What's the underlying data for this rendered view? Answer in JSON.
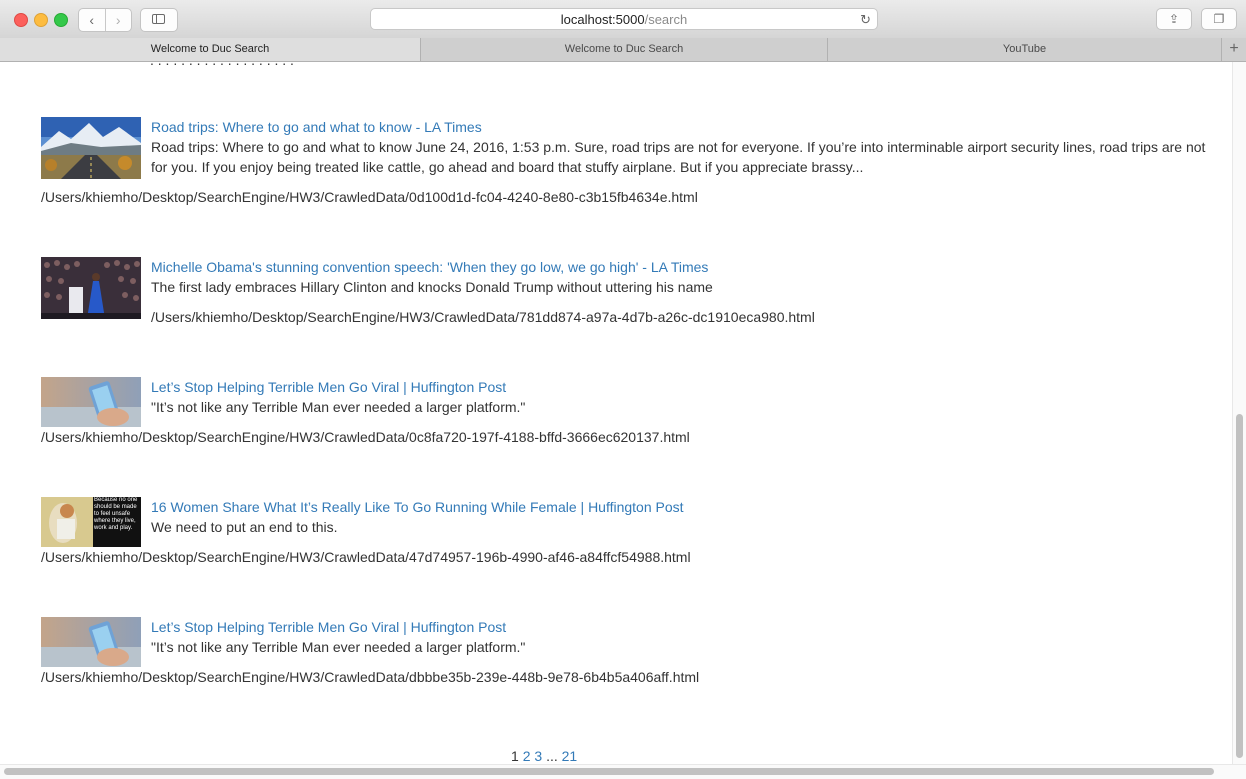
{
  "browser": {
    "url_host": "localhost:5000",
    "url_path": "/search",
    "back_glyph": "‹",
    "forward_glyph": "›",
    "reload_glyph": "↻",
    "share_glyph": "⇪",
    "tabs_glyph": "❐",
    "new_tab_glyph": "+",
    "tabs": [
      {
        "label": "Welcome to Duc Search",
        "active": true
      },
      {
        "label": "Welcome to Duc Search",
        "active": false
      },
      {
        "label": "YouTube",
        "active": false
      }
    ]
  },
  "results": [
    {
      "title": "Road trips: Where to go and what to know - LA Times",
      "snippet": "Road trips: Where to go and what to know June 24, 2016, 1:53 p.m. Sure, road trips are not for everyone. If you’re into interminable airport security lines, road trips are not for you. If you enjoy being treated like cattle, go ahead and board that stuffy airplane. But if you appreciate brassy...",
      "path": "/Users/khiemho/Desktop/SearchEngine/HW3/CrawledData/0d100d1d-fc04-4240-8e80-c3b15fb4634e.html",
      "thumb": "road-image"
    },
    {
      "title": "Michelle Obama's stunning convention speech: 'When they go low, we go high' - LA Times",
      "snippet": "The first lady embraces Hillary Clinton and knocks Donald Trump without uttering his name",
      "path": "/Users/khiemho/Desktop/SearchEngine/HW3/CrawledData/781dd874-a97a-4d7b-a26c-dc1910eca980.html",
      "thumb": "convention-image"
    },
    {
      "title": "Let’s Stop Helping Terrible Men Go Viral | Huffington Post",
      "snippet": "\"It’s not like any Terrible Man ever needed a larger platform.\"",
      "path": "/Users/khiemho/Desktop/SearchEngine/HW3/CrawledData/0c8fa720-197f-4188-bffd-3666ec620137.html",
      "thumb": "phone-image"
    },
    {
      "title": "16 Women Share What It’s Really Like To Go Running While Female | Huffington Post",
      "snippet": "We need to put an end to this.",
      "path": "/Users/khiemho/Desktop/SearchEngine/HW3/CrawledData/47d74957-196b-4990-af46-a84ffcf54988.html",
      "thumb": "running-image",
      "thumb_caption": "Because no one should be made to feel unsafe where they live, work and play."
    },
    {
      "title": "Let’s Stop Helping Terrible Men Go Viral | Huffington Post",
      "snippet": "\"It’s not like any Terrible Man ever needed a larger platform.\"",
      "path": "/Users/khiemho/Desktop/SearchEngine/HW3/CrawledData/dbbbe35b-239e-448b-9e78-6b4b5a406aff.html",
      "thumb": "phone-image"
    }
  ],
  "pagination": {
    "current": "1",
    "pages": [
      "2",
      "3"
    ],
    "ellipsis": "...",
    "last": "21"
  },
  "colors": {
    "link": "#337ab7",
    "text": "#333333"
  }
}
